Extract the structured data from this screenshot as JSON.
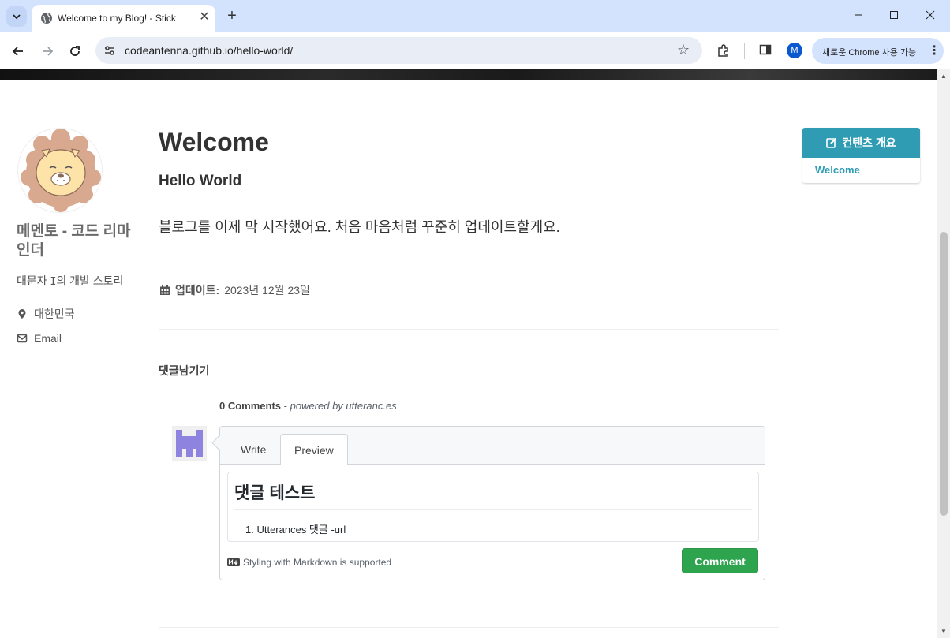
{
  "browser": {
    "tab_title": "Welcome to my Blog! - Stick",
    "url": "codeantenna.github.io/hello-world/",
    "profile_initial": "M",
    "chrome_pill": "새로운 Chrome 사용 가능",
    "new_tab": "+",
    "tab_close": "✕"
  },
  "author": {
    "name_part1": "메멘토 - ",
    "name_part2": "코드 리마",
    "name_part3": "인더",
    "bio_prefix": "대문자 ",
    "bio_mono": "I",
    "bio_suffix": "의 개발 스토리",
    "location": "대한민국",
    "email": "Email"
  },
  "post": {
    "title": "Welcome",
    "subtitle": "Hello World",
    "body": "블로그를 이제 막 시작했어요. 처음 마음처럼 꾸준히 업데이트할게요.",
    "updated_label": "업데이트:",
    "updated_value": "2023년 12월 23일"
  },
  "toc": {
    "heading": "컨텐츠 개요",
    "items": [
      "Welcome"
    ]
  },
  "comments": {
    "section_title": "댓글남기기",
    "count": "0 Comments",
    "separator": " - ",
    "powered_by": "powered by utteranc.es",
    "tabs": [
      "Write",
      "Preview"
    ],
    "active_tab": "Preview",
    "preview_heading": "댓글 테스트",
    "preview_list_item": "1. Utterances 댓글 -url",
    "markdown_note": "Styling with Markdown is supported",
    "submit_label": "Comment"
  },
  "colors": {
    "accent": "#2f9cb3",
    "submit": "#2ea44f",
    "tabbar": "#d3e3fd"
  }
}
